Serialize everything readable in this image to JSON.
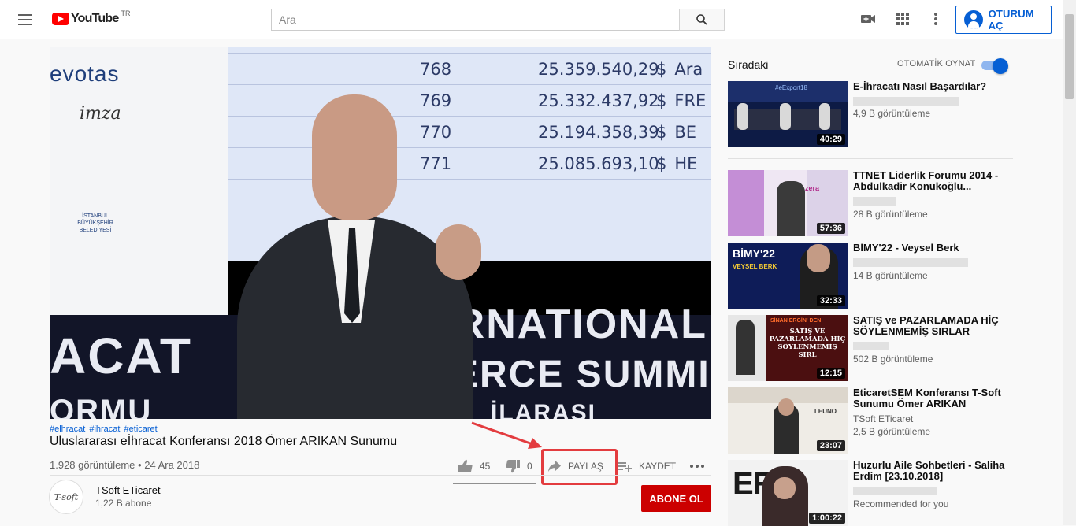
{
  "header": {
    "logo_text": "YouTube",
    "country_code": "TR",
    "search_placeholder": "Ara",
    "signin_label": "OTURUM AÇ"
  },
  "video": {
    "hashtags": [
      "#elhracat",
      "#ihracat",
      "#eticaret"
    ],
    "title": "Uluslararası eİhracat Konferansı 2018 Ömer ARIKAN Sunumu",
    "views": "1.928 görüntüleme",
    "date": "24 Ara 2018",
    "meta_separator": "•",
    "likes": "45",
    "dislikes": "0",
    "share_label": "PAYLAŞ",
    "save_label": "KAYDET",
    "like_ratio": 1.0
  },
  "player_scene": {
    "screen_rows": [
      {
        "num": "768",
        "amount": "25.359.540,29",
        "cur": "$",
        "tail": "Ara"
      },
      {
        "num": "769",
        "amount": "25.332.437,92",
        "cur": "$",
        "tail": "FRE"
      },
      {
        "num": "770",
        "amount": "25.194.358,39",
        "cur": "$",
        "tail": "BE"
      },
      {
        "num": "771",
        "amount": "25.085.693,10",
        "cur": "$",
        "tail": "HE"
      }
    ],
    "sponsor_1": "evotas",
    "sponsor_2": "imza",
    "sponsor_3": "İSTANBUL BÜYÜKŞEHİR BELEDİYESİ",
    "stage_text_1": "ERNATIONAL",
    "stage_text_2": "MERCE SUMMI",
    "stage_text_3": "ACAT",
    "stage_text_4": "ORMU",
    "stage_text_5": "İLARASI"
  },
  "channel": {
    "name": "TSoft ETicaret",
    "subscribers": "1,22 B abone",
    "avatar_text": "T-soft",
    "subscribe_label": "ABONE OL"
  },
  "sidebar": {
    "up_next_label": "Sıradaki",
    "autoplay_label": "OTOMATİK OYNAT",
    "autoplay_on": true,
    "items": [
      {
        "title": "E-İhracatı Nasıl Başardılar?",
        "channel": "",
        "views": "4,9 B görüntüleme",
        "duration": "40:29",
        "thumb_text": "#eExport18"
      },
      {
        "title": "TTNET Liderlik Forumu 2014 - Abdulkadir Konukoğlu...",
        "channel": "",
        "views": "28 B görüntüleme",
        "duration": "57:36",
        "thumb_text": "zera"
      },
      {
        "title": "BİMY'22 - Veysel Berk",
        "channel": "",
        "views": "14 B görüntüleme",
        "duration": "32:33",
        "thumb_text": "BİMY'22",
        "thumb_sub": "VEYSEL BERK"
      },
      {
        "title": "SATIŞ ve PAZARLAMADA HİÇ SÖYLENMEMİŞ SIRLAR",
        "channel": "",
        "views": "502 B görüntüleme",
        "duration": "12:15",
        "thumb_text": "SİNAN ERGİN' DEN",
        "thumb_sub": "SATIŞ VE PAZARLAMADA HİÇ SÖYLENMEMİŞ SIRL"
      },
      {
        "title": "EticaretSEM Konferansı T-Soft Sunumu Ömer ARIKAN",
        "channel": "TSoft ETicaret",
        "views": "2,5 B görüntüleme",
        "duration": "23:07",
        "thumb_text": "LEUNO"
      },
      {
        "title": "Huzurlu Aile Sohbetleri - Saliha Erdim [23.10.2018]",
        "channel": "",
        "views": "Recommended for you",
        "duration": "1:00:22",
        "thumb_text": "ERİ"
      }
    ]
  },
  "colors": {
    "brand_red": "#ff0000",
    "link_blue": "#065fd4",
    "subscribe_red": "#cc0000",
    "annotation_red": "#e33c3f"
  }
}
